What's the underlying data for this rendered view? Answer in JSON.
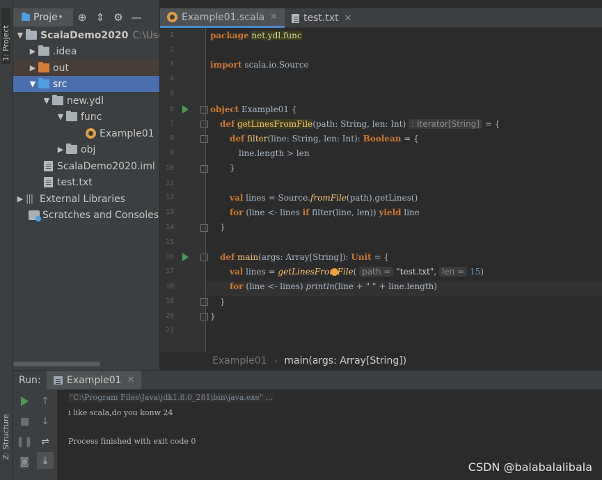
{
  "left_strip": {
    "project_tab": "1: Project",
    "structure_tab": "Z: Structure"
  },
  "project_panel": {
    "title": "Proje",
    "tree": [
      {
        "label": "ScalaDemo2020",
        "extra": "C:\\Users",
        "arrow": "▼",
        "icon": "folder-grey"
      },
      {
        "label": ".idea",
        "arrow": "▶",
        "icon": "folder-grey"
      },
      {
        "label": "out",
        "arrow": "▶",
        "icon": "folder-orange"
      },
      {
        "label": "src",
        "arrow": "▼",
        "icon": "folder-blue"
      },
      {
        "label": "new.ydl",
        "arrow": "▼",
        "icon": "folder-grey"
      },
      {
        "label": "func",
        "arrow": "▼",
        "icon": "folder-grey"
      },
      {
        "label": "Example01",
        "icon": "scala-object"
      },
      {
        "label": "obj",
        "arrow": "▶",
        "icon": "folder-grey"
      },
      {
        "label": "ScalaDemo2020.iml",
        "icon": "module-file"
      },
      {
        "label": "test.txt",
        "icon": "text-file"
      },
      {
        "label": "External Libraries",
        "arrow": "▶",
        "icon": "library"
      },
      {
        "label": "Scratches and Consoles",
        "icon": "scratches"
      }
    ]
  },
  "editor_tabs": [
    {
      "label": "Example01.scala",
      "active": true
    },
    {
      "label": "test.txt",
      "active": false
    }
  ],
  "editor": {
    "line_numbers": [
      "1",
      "2",
      "3",
      "4",
      "5",
      "6",
      "7",
      "8",
      "9",
      "10",
      "11",
      "12",
      "13",
      "14",
      "15",
      "16",
      "17",
      "18",
      "19",
      "20",
      "21"
    ],
    "lines": {
      "l1_kw": "package",
      "l1_pkg": "net.ydl.func",
      "l3_kw": "import",
      "l3_rest": " scala.io.Source",
      "l6_kw": "object",
      "l6_rest": " Example01 {",
      "l7_kw": "def",
      "l7_fn": "getLinesFromFile",
      "l7_rest": "(path: String, len: Int)",
      "l7_hint": ": Iterator[String]",
      "l7_end": " = {",
      "l8_kw": "def",
      "l8_fn": "filter",
      "l8_rest": "(line: String, len: Int): ",
      "l8_kw2": "Boolean",
      "l8_end": " = {",
      "l9": "line.length > len",
      "l10": "}",
      "l12_kw": "val",
      "l12_rest": " lines = Source.",
      "l12_it": "fromFile",
      "l12_end": "(path).getLines()",
      "l13_kw": "for",
      "l13_a": " (line <- lines ",
      "l13_kw2": "if",
      "l13_b": " filter(line, len)) ",
      "l13_kw3": "yield",
      "l13_c": " line",
      "l14": "}",
      "l16_kw": "def",
      "l16_fn": "main",
      "l16_rest": "(args: Array[String]): ",
      "l16_kw2": "Unit",
      "l16_end": " = {",
      "l17_kw": "val",
      "l17_rest": " lines = ",
      "l17_it": "getLinesFromFile",
      "l17_open": "(",
      "l17_hint1": "path =",
      "l17_str": " \"test.txt\",",
      "l17_hint2": "len =",
      "l17_num": " 15",
      "l17_close": ")",
      "l18_kw": "for",
      "l18_a": " (line <- lines) ",
      "l18_it": "println",
      "l18_b": "(line + \" \" + line.length)",
      "l19": "}",
      "l20": "}"
    }
  },
  "breadcrumb": {
    "class_name": "Example01",
    "method": "main(args: Array[String])"
  },
  "run_panel": {
    "label": "Run:",
    "tab": "Example01",
    "console": [
      "\"C:\\Program Files\\Java\\jdk1.8.0_281\\bin\\java.exe\" ...",
      "i like scala,do you konw 24",
      "",
      "Process finished with exit code 0"
    ]
  },
  "watermark": "CSDN @balabalalibala",
  "colors": {
    "selection": "#4b6eaf",
    "keyword": "#cc7832",
    "function": "#ffc66d",
    "run_green": "#499c54"
  }
}
